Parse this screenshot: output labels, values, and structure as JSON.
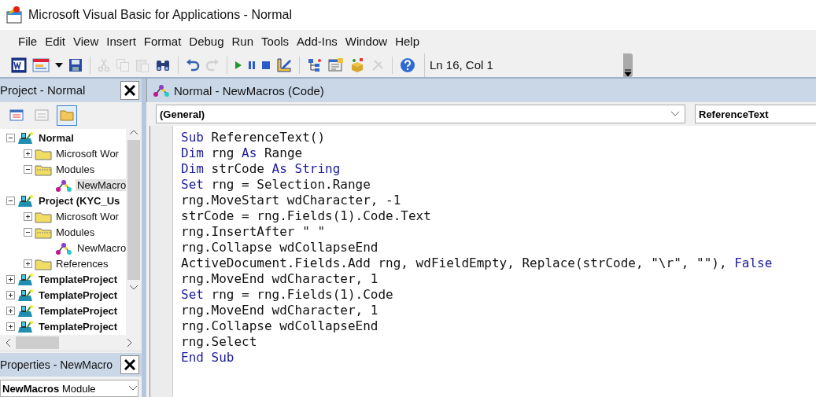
{
  "window": {
    "title": "Microsoft Visual Basic for Applications - Normal"
  },
  "menu": [
    {
      "label": "File"
    },
    {
      "label": "Edit"
    },
    {
      "label": "View"
    },
    {
      "label": "Insert"
    },
    {
      "label": "Format"
    },
    {
      "label": "Debug"
    },
    {
      "label": "Run"
    },
    {
      "label": "Tools"
    },
    {
      "label": "Add-Ins"
    },
    {
      "label": "Window"
    },
    {
      "label": "Help"
    }
  ],
  "toolbar": [
    {
      "kind": "word",
      "disabled": false
    },
    {
      "kind": "userform",
      "disabled": false
    },
    {
      "kind": "caret",
      "disabled": false
    },
    {
      "kind": "save",
      "disabled": false
    },
    {
      "kind": "sep"
    },
    {
      "kind": "cut",
      "disabled": true
    },
    {
      "kind": "copy",
      "disabled": true
    },
    {
      "kind": "paste",
      "disabled": true
    },
    {
      "kind": "find",
      "disabled": false
    },
    {
      "kind": "sep"
    },
    {
      "kind": "undo",
      "disabled": false
    },
    {
      "kind": "redo",
      "disabled": true
    },
    {
      "kind": "sep"
    },
    {
      "kind": "run",
      "disabled": false
    },
    {
      "kind": "pause",
      "disabled": false
    },
    {
      "kind": "stop",
      "disabled": false
    },
    {
      "kind": "design",
      "disabled": false
    },
    {
      "kind": "sep"
    },
    {
      "kind": "explorer",
      "disabled": false
    },
    {
      "kind": "properties",
      "disabled": false
    },
    {
      "kind": "browser",
      "disabled": false
    },
    {
      "kind": "toolbox",
      "disabled": true
    },
    {
      "kind": "sep"
    },
    {
      "kind": "help",
      "disabled": false
    }
  ],
  "cursor_position": "Ln 16, Col 1",
  "project_panel": {
    "title": "Project - Normal",
    "buttons": [
      {
        "kind": "view_code",
        "selected": false
      },
      {
        "kind": "view_object",
        "selected": false
      },
      {
        "kind": "toggle_folders",
        "selected": true
      }
    ],
    "tree": [
      {
        "label": "Normal",
        "kind": "project",
        "expanded": true,
        "selected": false,
        "children": [
          {
            "label": "Microsoft Wor",
            "kind": "folder",
            "expanded": false,
            "selected": false
          },
          {
            "label": "Modules",
            "kind": "folder",
            "expanded": true,
            "selected": false,
            "children": [
              {
                "label": "NewMacro",
                "kind": "module",
                "selected": true
              }
            ]
          }
        ]
      },
      {
        "label": "Project (KYC_Us",
        "kind": "project",
        "expanded": true,
        "selected": false,
        "children": [
          {
            "label": "Microsoft Wor",
            "kind": "folder",
            "expanded": false,
            "selected": false
          },
          {
            "label": "Modules",
            "kind": "folder",
            "expanded": true,
            "selected": false,
            "children": [
              {
                "label": "NewMacro",
                "kind": "module",
                "selected": false
              }
            ]
          },
          {
            "label": "References",
            "kind": "folder",
            "expanded": false,
            "selected": false
          }
        ]
      },
      {
        "label": "TemplateProject",
        "kind": "project",
        "expanded": false,
        "selected": false
      },
      {
        "label": "TemplateProject",
        "kind": "project",
        "expanded": false,
        "selected": false
      },
      {
        "label": "TemplateProject",
        "kind": "project",
        "expanded": false,
        "selected": false
      },
      {
        "label": "TemplateProject",
        "kind": "project",
        "expanded": false,
        "selected": false
      }
    ]
  },
  "properties_panel": {
    "title": "Properties - NewMacro",
    "object_name": "NewMacros",
    "object_type": "Module"
  },
  "code_window": {
    "title": "Normal - NewMacros (Code)",
    "object_combo": "(General)",
    "procedure_combo": "ReferenceText",
    "lines": [
      [
        {
          "kind": "keyword",
          "text": "Sub"
        },
        {
          "kind": "plain",
          "text": " ReferenceText()"
        }
      ],
      [
        {
          "kind": "keyword",
          "text": "Dim"
        },
        {
          "kind": "plain",
          "text": " rng "
        },
        {
          "kind": "keyword",
          "text": "As"
        },
        {
          "kind": "plain",
          "text": " Range"
        }
      ],
      [
        {
          "kind": "keyword",
          "text": "Dim"
        },
        {
          "kind": "plain",
          "text": " strCode "
        },
        {
          "kind": "keyword",
          "text": "As String"
        }
      ],
      [
        {
          "kind": "keyword",
          "text": "Set"
        },
        {
          "kind": "plain",
          "text": " rng = Selection.Range"
        }
      ],
      [
        {
          "kind": "plain",
          "text": "rng.MoveStart wdCharacter, -1"
        }
      ],
      [
        {
          "kind": "plain",
          "text": "strCode = rng.Fields(1).Code.Text"
        }
      ],
      [
        {
          "kind": "plain",
          "text": "rng.InsertAfter \" \""
        }
      ],
      [
        {
          "kind": "plain",
          "text": "rng.Collapse wdCollapseEnd"
        }
      ],
      [
        {
          "kind": "plain",
          "text": "ActiveDocument.Fields.Add rng, wdFieldEmpty, Replace(strCode, \"\\r\", \"\"), "
        },
        {
          "kind": "keyword",
          "text": "False"
        }
      ],
      [
        {
          "kind": "plain",
          "text": "rng.MoveEnd wdCharacter, 1"
        }
      ],
      [
        {
          "kind": "keyword",
          "text": "Set"
        },
        {
          "kind": "plain",
          "text": " rng = rng.Fields(1).Code"
        }
      ],
      [
        {
          "kind": "plain",
          "text": "rng.MoveEnd wdCharacter, 1"
        }
      ],
      [
        {
          "kind": "plain",
          "text": "rng.Collapse wdCollapseEnd"
        }
      ],
      [
        {
          "kind": "plain",
          "text": "rng.Select"
        }
      ],
      [
        {
          "kind": "keyword",
          "text": "End Sub"
        }
      ]
    ]
  }
}
